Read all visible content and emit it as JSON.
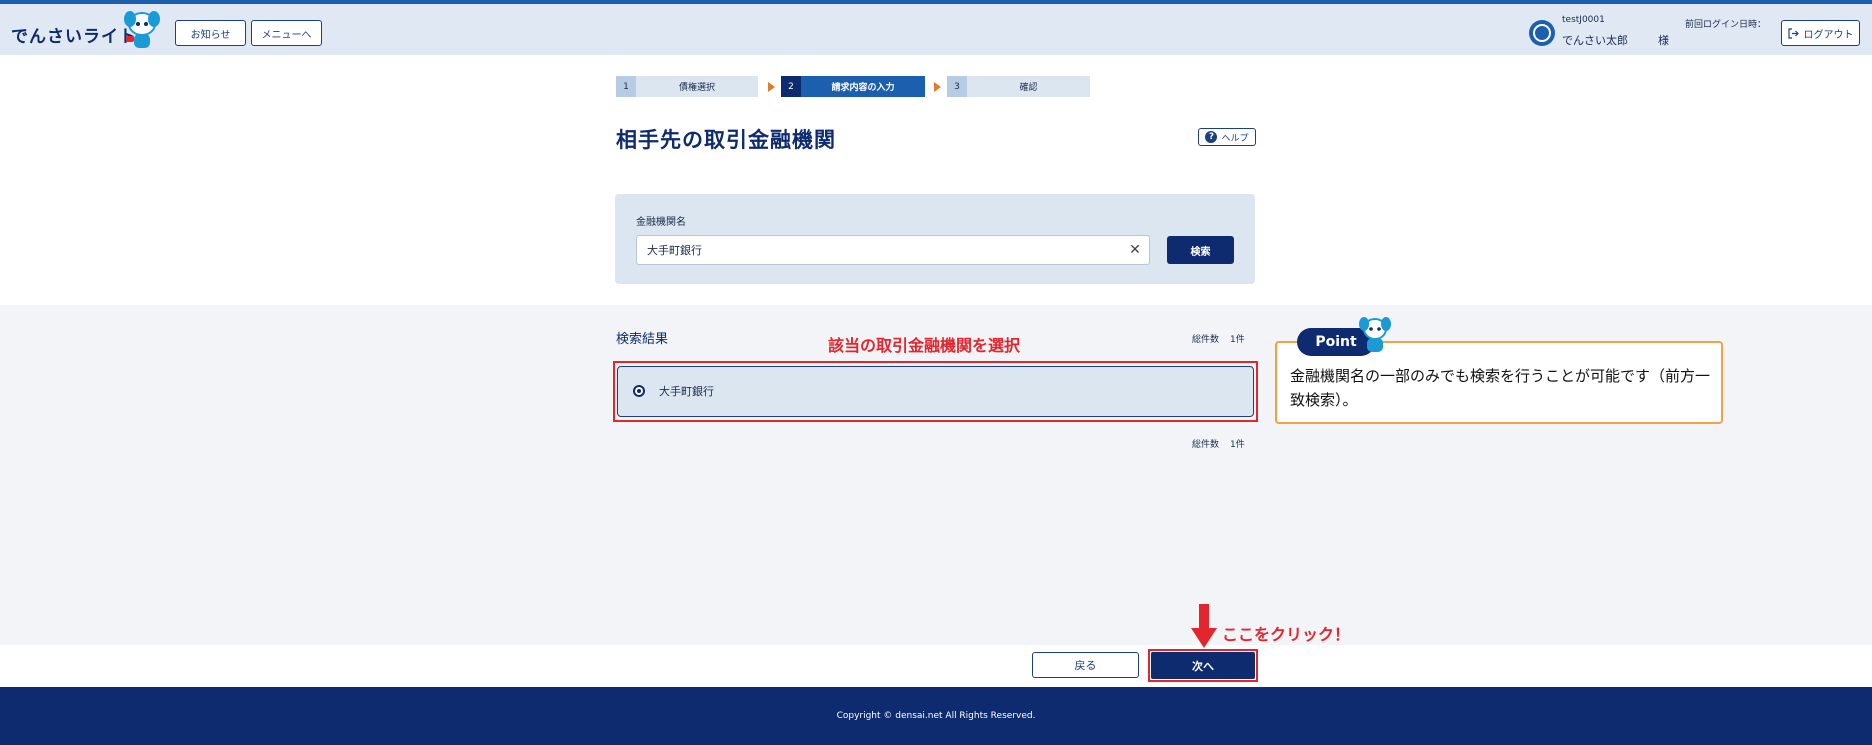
{
  "header": {
    "logo": "でんさいライト",
    "notice_button": "お知らせ",
    "menu_button": "メニューへ",
    "user_id": "testJ0001",
    "user_name": "でんさい太郎",
    "honorific": "様",
    "last_login_label": "前回ログイン日時：",
    "logout_button": "ログアウト"
  },
  "steps": [
    {
      "num": "1",
      "label": "債権選択",
      "state": "done"
    },
    {
      "num": "2",
      "label": "請求内容の入力",
      "state": "current"
    },
    {
      "num": "3",
      "label": "確認",
      "state": "todo"
    }
  ],
  "page": {
    "title": "相手先の取引金融機関",
    "help_button": "ヘルプ"
  },
  "search": {
    "label": "金融機関名",
    "value": "大手町銀行",
    "button": "検索"
  },
  "results": {
    "title": "検索結果",
    "count_label": "総件数",
    "count_value": "1件",
    "items": [
      {
        "name": "大手町銀行",
        "selected": true
      }
    ]
  },
  "annotations": {
    "select_bank": "該当の取引金融機関を選択",
    "click_here": "ここをクリック！",
    "point_label": "Point",
    "point_text": "金融機関名の一部のみでも検索を行うことが可能です（前方一致検索）。"
  },
  "footer": {
    "back_button": "戻る",
    "next_button": "次へ",
    "copyright": "Copyright © densai.net All Rights Reserved."
  },
  "colors": {
    "navy": "#0d2b6e",
    "header_bg": "#dfe8f3",
    "panel_bg": "#dbe6f1",
    "accent_red": "#e3262d",
    "point_orange": "#f0a245",
    "step_arrow": "#e07b2a"
  }
}
